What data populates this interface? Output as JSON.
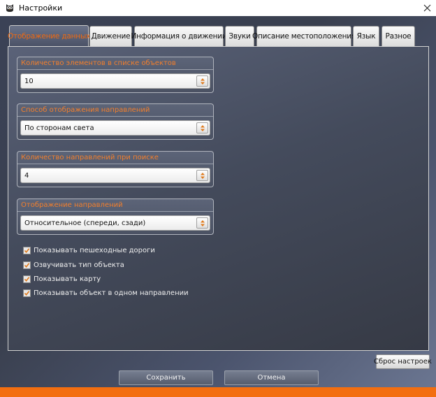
{
  "window": {
    "title": "Настройки",
    "close_glyph": "✕"
  },
  "tabs": [
    {
      "label": "Отображение данных",
      "active": true
    },
    {
      "label": "Движение",
      "active": false
    },
    {
      "label": "Информация о движении",
      "active": false
    },
    {
      "label": "Звуки",
      "active": false
    },
    {
      "label": "Описание местоположения",
      "active": false
    },
    {
      "label": "Язык",
      "active": false
    },
    {
      "label": "Разное",
      "active": false
    }
  ],
  "groups": [
    {
      "label": "Количество элементов в списке объектов",
      "value": "10"
    },
    {
      "label": "Способ отображения направлений",
      "value": "По сторонам света"
    },
    {
      "label": "Количество направлений при поиске",
      "value": "4"
    },
    {
      "label": "Отображение направлений",
      "value": "Относительное (спереди, сзади)"
    }
  ],
  "checkboxes": [
    {
      "label": "Показывать пешеходные дороги",
      "checked": true
    },
    {
      "label": "Озвучивать тип объекта",
      "checked": true
    },
    {
      "label": "Показывать карту",
      "checked": true
    },
    {
      "label": "Показывать объект в одном направлении",
      "checked": true
    }
  ],
  "buttons": {
    "reset": "Сброс настроек",
    "save": "Сохранить",
    "cancel": "Отмена"
  },
  "colors": {
    "accent": "#f06a12",
    "bottom_bar": "#f36e10"
  },
  "icons": {
    "app": "owl-icon",
    "close": "close-icon",
    "spin": "spin-arrows-icon",
    "check": "checkmark-icon"
  }
}
